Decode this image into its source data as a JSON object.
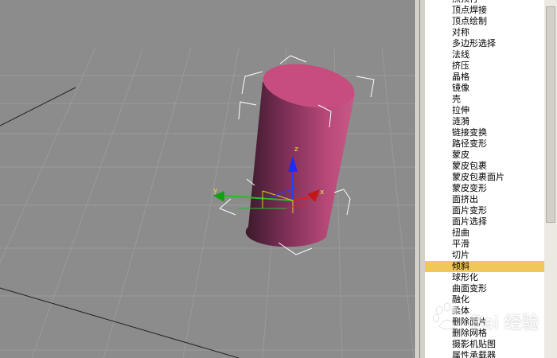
{
  "viewport": {
    "axis_labels": {
      "x": "x",
      "y": "y",
      "z": "z"
    },
    "colors": {
      "background": "#8c8c8c",
      "grid": "#9c9c9c",
      "cylinder_top": "#c64d7e",
      "cylinder_body": "#a23c6a",
      "bbox": "#ffffff"
    }
  },
  "modifier_list": {
    "items": [
      "照顶行",
      "顶点焊接",
      "顶点绘制",
      "对称",
      "多边形选择",
      "法线",
      "挤压",
      "晶格",
      "镜像",
      "壳",
      "拉伸",
      "涟漪",
      "链接变换",
      "路径变形",
      "蒙皮",
      "蒙皮包裹",
      "蒙皮包裹面片",
      "蒙皮变形",
      "面挤出",
      "面片变形",
      "面片选择",
      "扭曲",
      "平滑",
      "切片",
      "倾斜",
      "球形化",
      "曲面变形",
      "融化",
      "柔体",
      "删除面片",
      "删除网格",
      "摄影机贴图",
      "属性承载器"
    ],
    "selected_index": 24
  },
  "watermark": {
    "text": "Bai 经验",
    "icon": "paw-logo-icon"
  }
}
